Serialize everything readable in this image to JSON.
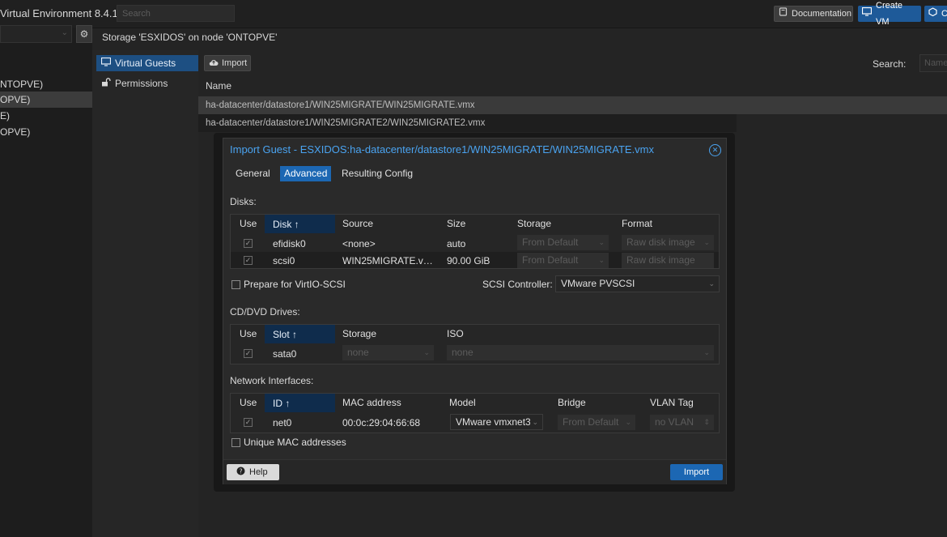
{
  "colors": {
    "accent": "#1c67b3",
    "title_blue": "#4aa3f0",
    "selection": "#1d4f82"
  },
  "topbar": {
    "brand": "Virtual Environment 8.4.1",
    "search_placeholder": "Search",
    "documentation": "Documentation",
    "create_vm": "Create VM",
    "create_ct": "C",
    "icons": [
      "book-icon",
      "monitor-icon",
      "cube-icon"
    ]
  },
  "tree": {
    "items": [
      "NTOPVE)",
      "OPVE)",
      "E)",
      "OPVE)"
    ],
    "selected_index": 1
  },
  "storage_title": "Storage 'ESXIDOS' on node 'ONTOPVE'",
  "nav": {
    "virtual_guests": "Virtual Guests",
    "permissions": "Permissions"
  },
  "toolbar": {
    "import": "Import",
    "search_label": "Search:",
    "search_placeholder": "Name"
  },
  "guests": {
    "header": "Name",
    "rows": [
      "ha-datacenter/datastore1/WIN25MIGRATE/WIN25MIGRATE.vmx",
      "ha-datacenter/datastore1/WIN25MIGRATE2/WIN25MIGRATE2.vmx"
    ]
  },
  "modal": {
    "title": "Import Guest - ESXIDOS:ha-datacenter/datastore1/WIN25MIGRATE/WIN25MIGRATE.vmx",
    "tabs": [
      "General",
      "Advanced",
      "Resulting Config"
    ],
    "active_tab": "Advanced",
    "disks": {
      "label": "Disks:",
      "headers": [
        "Use",
        "Disk ↑",
        "Source",
        "Size",
        "Storage",
        "Format"
      ],
      "rows": [
        {
          "use": true,
          "disk": "efidisk0",
          "source": "<none>",
          "size": "auto",
          "storage": "From Default",
          "format": "Raw disk image"
        },
        {
          "use": true,
          "disk": "scsi0",
          "source": "WIN25MIGRATE.v…",
          "size": "90.00 GiB",
          "storage": "From Default",
          "format": "Raw disk image"
        }
      ]
    },
    "virtio": {
      "label": "Prepare for VirtIO-SCSI",
      "checked": false
    },
    "scsi_controller": {
      "label": "SCSI Controller:",
      "value": "VMware PVSCSI"
    },
    "cdrom": {
      "label": "CD/DVD Drives:",
      "headers": [
        "Use",
        "Slot ↑",
        "Storage",
        "ISO"
      ],
      "rows": [
        {
          "use": true,
          "slot": "sata0",
          "storage": "none",
          "iso": "none"
        }
      ]
    },
    "network": {
      "label": "Network Interfaces:",
      "headers": [
        "Use",
        "ID ↑",
        "MAC address",
        "Model",
        "Bridge",
        "VLAN Tag"
      ],
      "rows": [
        {
          "use": true,
          "id": "net0",
          "mac": "00:0c:29:04:66:68",
          "model": "VMware vmxnet3",
          "bridge": "From Default",
          "vlan": "no VLAN"
        }
      ]
    },
    "unique_mac": {
      "label": "Unique MAC addresses",
      "checked": false
    },
    "help": "Help",
    "import": "Import"
  }
}
